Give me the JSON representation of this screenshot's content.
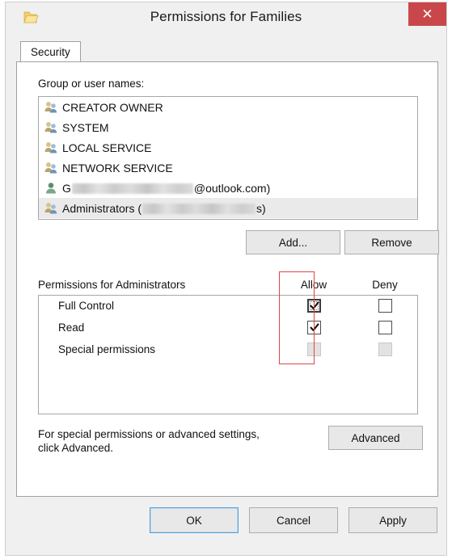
{
  "window": {
    "title": "Permissions for Families",
    "icon": "folder-icon",
    "close_label": "✕"
  },
  "tabs": [
    {
      "label": "Security",
      "active": true
    }
  ],
  "group_section": {
    "label": "Group or user names:",
    "items": [
      {
        "icon": "group-icon",
        "text": "CREATOR OWNER",
        "selected": false,
        "redacted": false
      },
      {
        "icon": "group-icon",
        "text": "SYSTEM",
        "selected": false,
        "redacted": false
      },
      {
        "icon": "group-icon",
        "text": "LOCAL SERVICE",
        "selected": false,
        "redacted": false
      },
      {
        "icon": "group-icon",
        "text": "NETWORK SERVICE",
        "selected": false,
        "redacted": false
      },
      {
        "icon": "user-icon",
        "text_prefix": "G",
        "text_suffix": "@outlook.com)",
        "selected": false,
        "redacted": true
      },
      {
        "icon": "group-icon",
        "text_prefix": "Administrators (",
        "text_suffix": "s)",
        "selected": true,
        "redacted": true
      }
    ],
    "add_label": "Add...",
    "remove_label": "Remove"
  },
  "permissions_section": {
    "label": "Permissions for Administrators",
    "allow_column": "Allow",
    "deny_column": "Deny",
    "rows": [
      {
        "name": "Full Control",
        "allow": "checked",
        "deny": "unchecked",
        "allow_focused": true,
        "disabled": false
      },
      {
        "name": "Read",
        "allow": "checked",
        "deny": "unchecked",
        "allow_focused": false,
        "disabled": false
      },
      {
        "name": "Special permissions",
        "allow": "disabled",
        "deny": "disabled",
        "allow_focused": false,
        "disabled": true
      }
    ],
    "annotation_color": "#e04444"
  },
  "footer": {
    "hint_line1": "For special permissions or advanced settings,",
    "hint_line2": "click Advanced.",
    "advanced_label": "Advanced"
  },
  "dialog_buttons": {
    "ok_label": "OK",
    "cancel_label": "Cancel",
    "apply_label": "Apply"
  },
  "colors": {
    "titlebar_bg": "#f0f0f0",
    "close_bg": "#c9474a",
    "panel_bg": "#ffffff",
    "selection_bg": "#eaeaea",
    "focus_border": "#5a9fd4",
    "annotation_red": "#e04444"
  }
}
